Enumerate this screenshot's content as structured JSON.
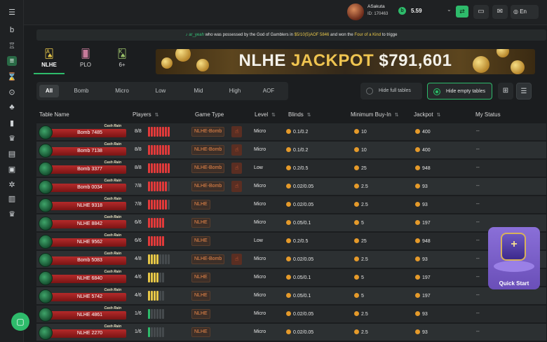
{
  "sidebar": {
    "items": [
      {
        "icon": "menu-icon",
        "glyph": "☰"
      },
      {
        "icon": "brand-logo-icon",
        "glyph": "b"
      },
      {
        "icon": "trophy-icon",
        "glyph": "♖"
      },
      {
        "icon": "cash-tables-icon",
        "glyph": "≡",
        "active": true
      },
      {
        "icon": "tournament-icon",
        "glyph": "⌛"
      },
      {
        "icon": "chips-icon",
        "glyph": "⊙"
      },
      {
        "icon": "club-icon",
        "glyph": "♣"
      },
      {
        "icon": "leaderboard-icon",
        "glyph": "▮"
      },
      {
        "icon": "crown-icon",
        "glyph": "♛"
      },
      {
        "icon": "book-icon",
        "glyph": "▤"
      },
      {
        "icon": "gift-icon",
        "glyph": "▣"
      },
      {
        "icon": "wheel-icon",
        "glyph": "✲"
      },
      {
        "icon": "stats-icon",
        "glyph": "▥"
      },
      {
        "icon": "vip-icon",
        "glyph": "♛"
      }
    ]
  },
  "user": {
    "name": "ASakuta",
    "id": "ID: 170463",
    "balance": "5.59"
  },
  "topbar": {
    "lang": "En"
  },
  "ticker": {
    "user": "ar_yeah",
    "text1": "who was possessed by the God of Gamblers in",
    "table": "$5/10(5)AOF 5846",
    "text2": "and won the",
    "hand": "Four of a Kind",
    "text3": "to trigge"
  },
  "game_tabs": [
    {
      "label": "NLHE",
      "active": true
    },
    {
      "label": "PLO",
      "active": false
    },
    {
      "label": "6+",
      "active": false
    }
  ],
  "banner": {
    "title": "NLHE",
    "jackpot_label": "JACKPOT",
    "amount": "$791,601"
  },
  "filters": [
    {
      "label": "All",
      "active": true
    },
    {
      "label": "Bomb"
    },
    {
      "label": "Micro"
    },
    {
      "label": "Low"
    },
    {
      "label": "Mid"
    },
    {
      "label": "High"
    },
    {
      "label": "AOF"
    }
  ],
  "toggles": {
    "hide_full": "Hide full tables",
    "hide_empty": "Hide empty tables"
  },
  "columns": {
    "table_name": "Table Name",
    "players": "Players",
    "game_type": "Game Type",
    "level": "Level",
    "blinds": "Blinds",
    "min_buyin": "Minimum Buy-In",
    "jackpot": "Jackpot",
    "status": "My Status"
  },
  "cash_rain_label": "Cash Rain",
  "rows": [
    {
      "name": "Bomb 7485",
      "players": "8/8",
      "filled": 8,
      "type": "NLHE-Bomb",
      "bomb": true,
      "level": "Micro",
      "blinds": "0.1/0.2",
      "buyin": "10",
      "jackpot": "400",
      "status": "--"
    },
    {
      "name": "Bomb 7138",
      "players": "8/8",
      "filled": 8,
      "type": "NLHE-Bomb",
      "bomb": true,
      "level": "Micro",
      "blinds": "0.1/0.2",
      "buyin": "10",
      "jackpot": "400",
      "status": "--"
    },
    {
      "name": "Bomb 3377",
      "players": "8/8",
      "filled": 8,
      "type": "NLHE-Bomb",
      "bomb": true,
      "level": "Low",
      "blinds": "0.2/0.5",
      "buyin": "25",
      "jackpot": "948",
      "status": "--"
    },
    {
      "name": "Bomb 0034",
      "players": "7/8",
      "filled": 7,
      "type": "NLHE-Bomb",
      "bomb": true,
      "level": "Micro",
      "blinds": "0.02/0.05",
      "buyin": "2.5",
      "jackpot": "93",
      "status": "--"
    },
    {
      "name": "NLHE 9318",
      "players": "7/8",
      "filled": 7,
      "type": "NLHE",
      "bomb": false,
      "level": "Micro",
      "blinds": "0.02/0.05",
      "buyin": "2.5",
      "jackpot": "93",
      "status": "--"
    },
    {
      "name": "NLHE 8842",
      "players": "6/6",
      "filled": 6,
      "type": "NLHE",
      "bomb": false,
      "level": "Micro",
      "blinds": "0.05/0.1",
      "buyin": "5",
      "jackpot": "197",
      "status": "--"
    },
    {
      "name": "NLHE 9562",
      "players": "6/6",
      "filled": 6,
      "type": "NLHE",
      "bomb": false,
      "level": "Low",
      "blinds": "0.2/0.5",
      "buyin": "25",
      "jackpot": "948",
      "status": "--"
    },
    {
      "name": "Bomb 5083",
      "players": "4/8",
      "filled": 4,
      "type": "NLHE-Bomb",
      "bomb": true,
      "level": "Micro",
      "blinds": "0.02/0.05",
      "buyin": "2.5",
      "jackpot": "93",
      "status": "--"
    },
    {
      "name": "NLHE 6840",
      "players": "4/6",
      "filled": 4,
      "type": "NLHE",
      "bomb": false,
      "level": "Micro",
      "blinds": "0.05/0.1",
      "buyin": "5",
      "jackpot": "197",
      "status": "--"
    },
    {
      "name": "NLHE 5742",
      "players": "4/6",
      "filled": 4,
      "type": "NLHE",
      "bomb": false,
      "level": "Micro",
      "blinds": "0.05/0.1",
      "buyin": "5",
      "jackpot": "197",
      "status": "--"
    },
    {
      "name": "NLHE 4861",
      "players": "1/6",
      "filled": 1,
      "type": "NLHE",
      "bomb": false,
      "level": "Micro",
      "blinds": "0.02/0.05",
      "buyin": "2.5",
      "jackpot": "93",
      "status": "--"
    },
    {
      "name": "NLHE 2270",
      "players": "1/6",
      "filled": 1,
      "type": "NLHE",
      "bomb": false,
      "level": "Micro",
      "blinds": "0.02/0.05",
      "buyin": "2.5",
      "jackpot": "93",
      "status": "--"
    }
  ],
  "quick_start": {
    "label": "Quick Start"
  },
  "colors": {
    "accent": "#2ebb6b",
    "full": "#e23a3a",
    "half": "#e7c747",
    "low": "#2ebb6b",
    "bomb": "#ee8a4a"
  }
}
